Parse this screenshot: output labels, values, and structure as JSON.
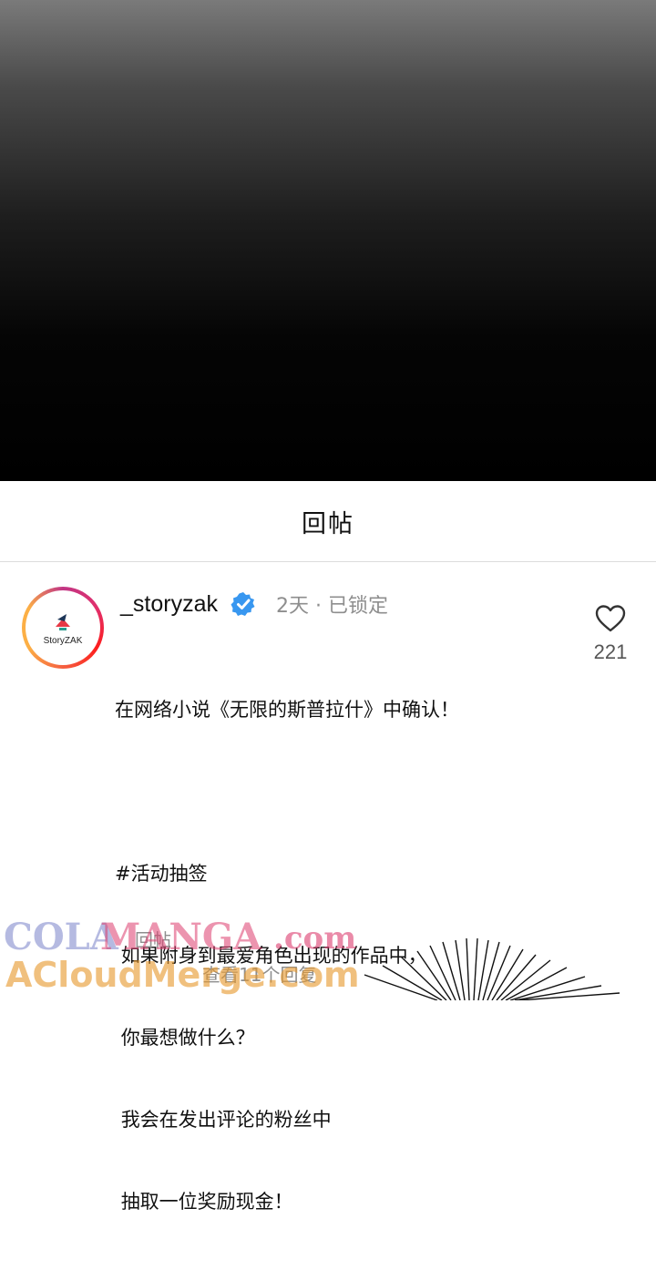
{
  "sheet": {
    "title": "回帖"
  },
  "comment": {
    "username": "_storyzak",
    "logo_text": "StoryZAK",
    "time": "2天 · 已锁定",
    "lines": [
      "在网络小说《无限的斯普拉什》中确认！",
      "",
      "#活动抽签",
      " 如果附身到最爱角色出现的作品中，",
      " 你最想做什么？",
      " 我会在发出评论的粉丝中",
      " 抽取一位奖励现金！"
    ],
    "like_count": "221",
    "reply_label": "回帖",
    "view_replies": "查看11个回复"
  },
  "watermark": {
    "part1": "COLA",
    "part2": "MANGA",
    "part3": ".com",
    "part4": "ACloudMerge.com"
  },
  "icons": {
    "verified": "verified-badge-icon",
    "like": "heart-icon"
  },
  "colors": {
    "verified": "#3897f0",
    "muted": "#8e8e8e"
  }
}
